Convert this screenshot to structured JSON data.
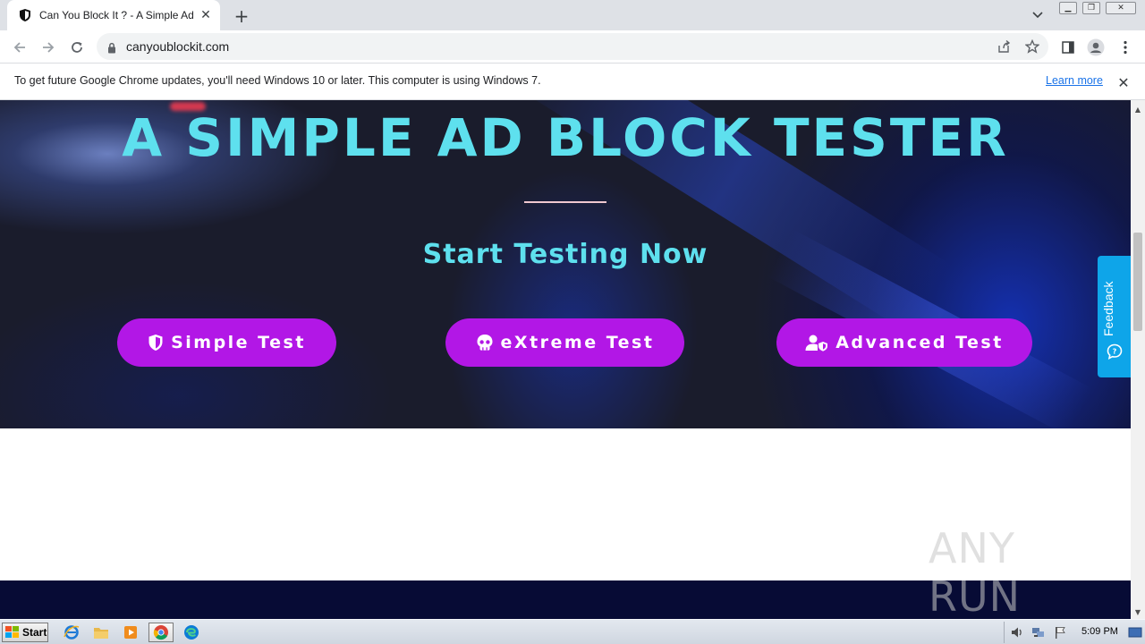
{
  "browser": {
    "tab": {
      "title": "Can You Block It ? - A Simple Ad Bloc"
    },
    "address": {
      "url": "canyoublockit.com"
    }
  },
  "infobar": {
    "message": "To get future Google Chrome updates, you'll need Windows 10 or later. This computer is using Windows 7.",
    "link": "Learn more"
  },
  "hero": {
    "title": "A SIMPLE AD BLOCK TESTER",
    "subtitle": "Start Testing Now",
    "buttons": [
      {
        "label": "Simple Test",
        "icon": "shield-icon"
      },
      {
        "label": "eXtreme Test",
        "icon": "skull-icon"
      },
      {
        "label": "Advanced Test",
        "icon": "user-shield-icon"
      }
    ]
  },
  "feedback": {
    "label": "Feedback"
  },
  "watermark": {
    "text": "ANY RUN"
  },
  "taskbar": {
    "start_label": "Start",
    "clock": "5:09 PM"
  },
  "colors": {
    "accent_cyan": "#5ee0ee",
    "button_purple": "#b217e6",
    "feedback_blue": "#0ea5e9",
    "hero_bg": "#1a1c2c",
    "dark_band": "#070b35"
  }
}
